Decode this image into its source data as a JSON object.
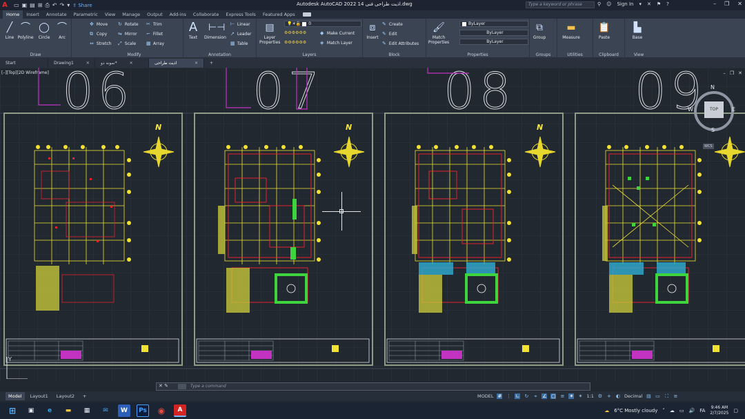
{
  "titlebar": {
    "app_letter": "A",
    "share_label": "Share",
    "title": "Autodesk AutoCAD 2022  اذیت طراحی فنی 14.dwg",
    "search_placeholder": "Type a keyword or phrase",
    "sign_in": "Sign In"
  },
  "ribbon_tabs": [
    "Home",
    "Insert",
    "Annotate",
    "Parametric",
    "View",
    "Manage",
    "Output",
    "Add-ins",
    "Collaborate",
    "Express Tools",
    "Featured Apps"
  ],
  "ribbon": {
    "draw": {
      "label": "Draw",
      "tools": [
        "Line",
        "Polyline",
        "Circle",
        "Arc"
      ]
    },
    "modify": {
      "label": "Modify",
      "tools": [
        "Move",
        "Rotate",
        "Trim",
        "Copy",
        "Mirror",
        "Fillet",
        "Stretch",
        "Scale",
        "Array"
      ]
    },
    "annotation": {
      "label": "Annotation",
      "text": "Text",
      "dimension": "Dimension",
      "linear": "Linear",
      "leader": "Leader",
      "table": "Table"
    },
    "layers": {
      "label": "Layers",
      "layer_properties": "Layer Properties",
      "current_layer": "0",
      "make_current": "Make Current",
      "match_layer": "Match Layer"
    },
    "block": {
      "label": "Block",
      "insert": "Insert",
      "create": "Create",
      "edit": "Edit",
      "edit_attributes": "Edit Attributes"
    },
    "properties": {
      "label": "Properties",
      "match_properties": "Match Properties",
      "color": "ByLayer",
      "linetype": "ByLayer",
      "lineweight": "ByLayer"
    },
    "groups": {
      "label": "Groups",
      "group": "Group"
    },
    "utilities": {
      "label": "Utilities",
      "measure": "Measure"
    },
    "clipboard": {
      "label": "Clipboard",
      "paste": "Paste"
    },
    "view": {
      "label": "View",
      "base": "Base"
    }
  },
  "file_tabs": [
    {
      "label": "Start"
    },
    {
      "label": "Drawing1"
    },
    {
      "label": "نمونه دو*"
    },
    {
      "label": "اذیت طراحی فنی 14*"
    }
  ],
  "viewport": {
    "label": "[–][Top][2D Wireframe]",
    "sheet_numbers": [
      "06",
      "07",
      "08",
      "09"
    ],
    "compass_letter": "N",
    "viewcube": {
      "top": "TOP",
      "n": "N",
      "s": "S",
      "e": "E",
      "w": "W",
      "wcs": "WCS"
    },
    "ucs_y": "Y"
  },
  "command": {
    "placeholder": "Type a command"
  },
  "layout_tabs": [
    "Model",
    "Layout1",
    "Layout2"
  ],
  "status": {
    "model": "MODEL",
    "scale": "1:1",
    "units": "Decimal"
  },
  "taskbar": {
    "weather": "6°C  Mostly cloudy",
    "lang": "FA",
    "time": "9:46 AM",
    "date": "2/7/2025"
  },
  "colors": {
    "accent": "#3b6fa3",
    "plan_red": "#e8212d",
    "plan_yellow": "#f2e233",
    "plan_green": "#3ed43e",
    "plan_blue": "#2fa6c9"
  }
}
